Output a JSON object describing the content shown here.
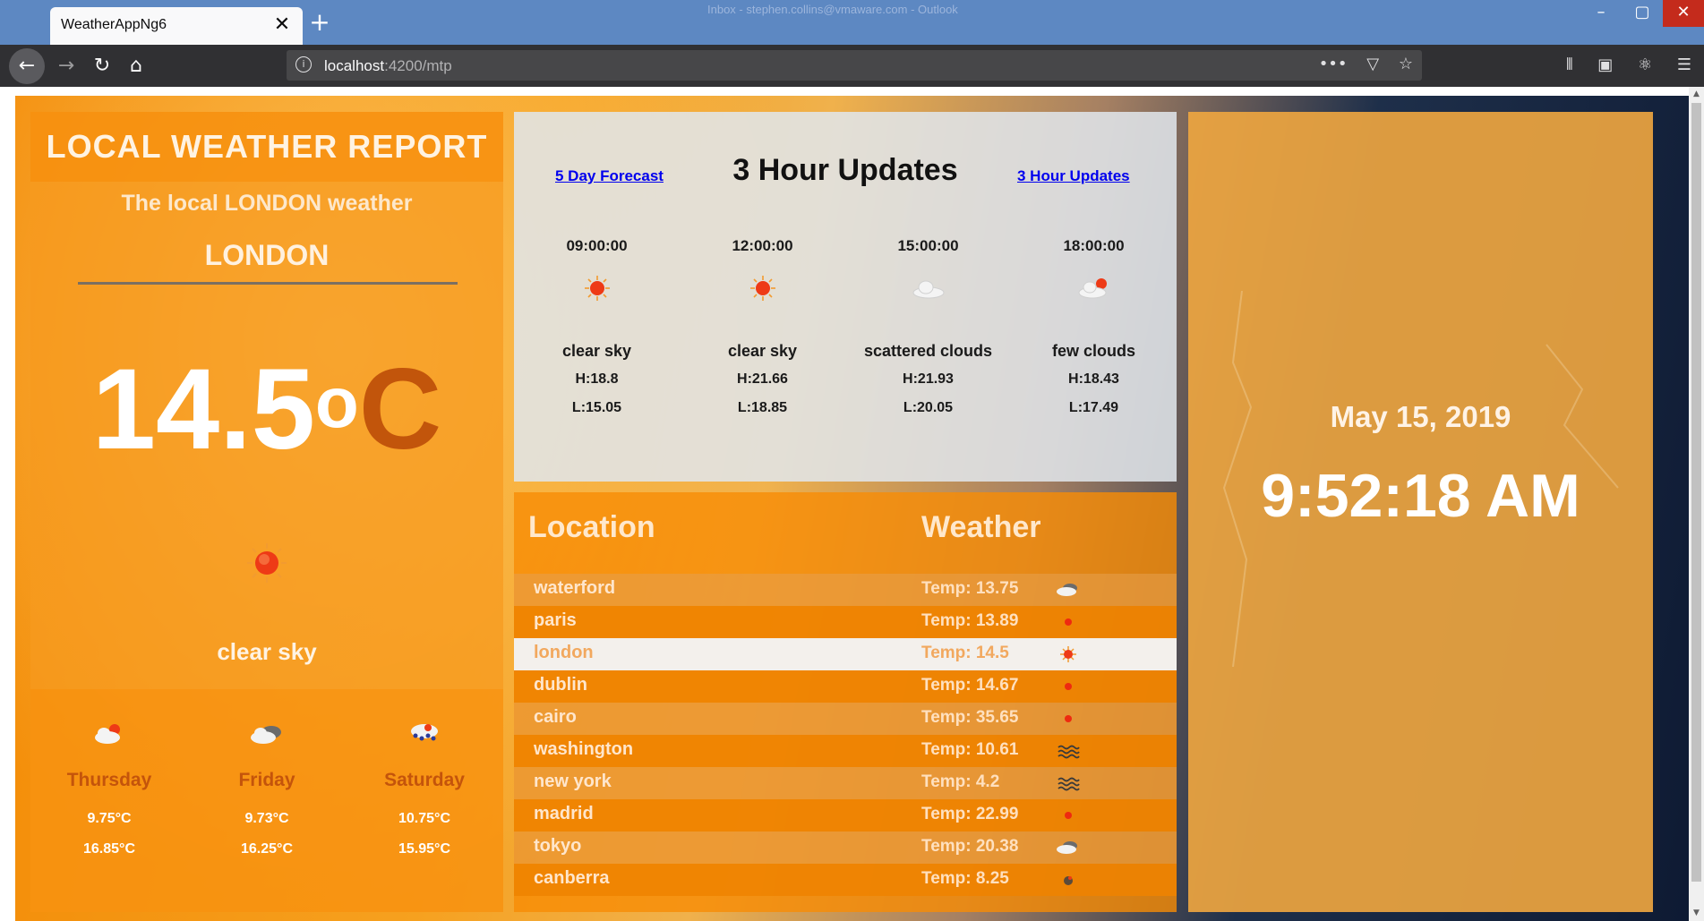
{
  "browser": {
    "tab_title": "WeatherAppNg6",
    "titlebar_hint": "Inbox - stephen.collins@vmaware.com - Outlook",
    "url_host": "localhost",
    "url_path": ":4200/mtp"
  },
  "local": {
    "title": "LOCAL WEATHER REPORT",
    "subtitle": "The local LONDON weather",
    "city": "LONDON",
    "temp_value": "14.5",
    "temp_degree": "o",
    "temp_unit": "C",
    "icon": "sun-icon",
    "description": "clear sky",
    "forecast": [
      {
        "day": "Thursday",
        "low": "9.75°C",
        "high": "16.85°C",
        "icon": "cloud-sun-icon"
      },
      {
        "day": "Friday",
        "low": "9.73°C",
        "high": "16.25°C",
        "icon": "dark-cloud-icon"
      },
      {
        "day": "Saturday",
        "low": "10.75°C",
        "high": "15.95°C",
        "icon": "rain-cloud-icon"
      }
    ]
  },
  "hourly": {
    "link_left": "5 Day Forecast",
    "title": "3 Hour Updates",
    "link_right": "3 Hour Updates",
    "slots": [
      {
        "time": "09:00:00",
        "desc": "clear sky",
        "hi": "H:18.8",
        "lo": "L:15.05",
        "icon": "sun-icon"
      },
      {
        "time": "12:00:00",
        "desc": "clear sky",
        "hi": "H:21.66",
        "lo": "L:18.85",
        "icon": "sun-icon"
      },
      {
        "time": "15:00:00",
        "desc": "scattered clouds",
        "hi": "H:21.93",
        "lo": "L:20.05",
        "icon": "cloud-icon"
      },
      {
        "time": "18:00:00",
        "desc": "few clouds",
        "hi": "H:18.43",
        "lo": "L:17.49",
        "icon": "cloud-sun-icon"
      }
    ]
  },
  "locations": {
    "header_location": "Location",
    "header_weather": "Weather",
    "rows": [
      {
        "city": "waterford",
        "temp": "Temp: 13.75",
        "icon": "cloud-icon"
      },
      {
        "city": "paris",
        "temp": "Temp: 13.89",
        "icon": "red-dot-icon"
      },
      {
        "city": "london",
        "temp": "Temp: 14.5",
        "icon": "sun-icon"
      },
      {
        "city": "dublin",
        "temp": "Temp: 14.67",
        "icon": "red-dot-icon"
      },
      {
        "city": "cairo",
        "temp": "Temp: 35.65",
        "icon": "red-dot-icon"
      },
      {
        "city": "washington",
        "temp": "Temp: 10.61",
        "icon": "mist-icon"
      },
      {
        "city": "new york",
        "temp": "Temp: 4.2",
        "icon": "mist-icon"
      },
      {
        "city": "madrid",
        "temp": "Temp: 22.99",
        "icon": "red-dot-icon"
      },
      {
        "city": "tokyo",
        "temp": "Temp: 20.38",
        "icon": "cloud-icon"
      },
      {
        "city": "canberra",
        "temp": "Temp: 8.25",
        "icon": "moon-icon"
      }
    ],
    "selected_city": "london"
  },
  "clock": {
    "date": "May 15, 2019",
    "time": "9:52:18 AM"
  },
  "colors": {
    "accent_orange": "#f79a1e",
    "unit_color": "#c2550b",
    "link_blue": "#0000ee"
  }
}
